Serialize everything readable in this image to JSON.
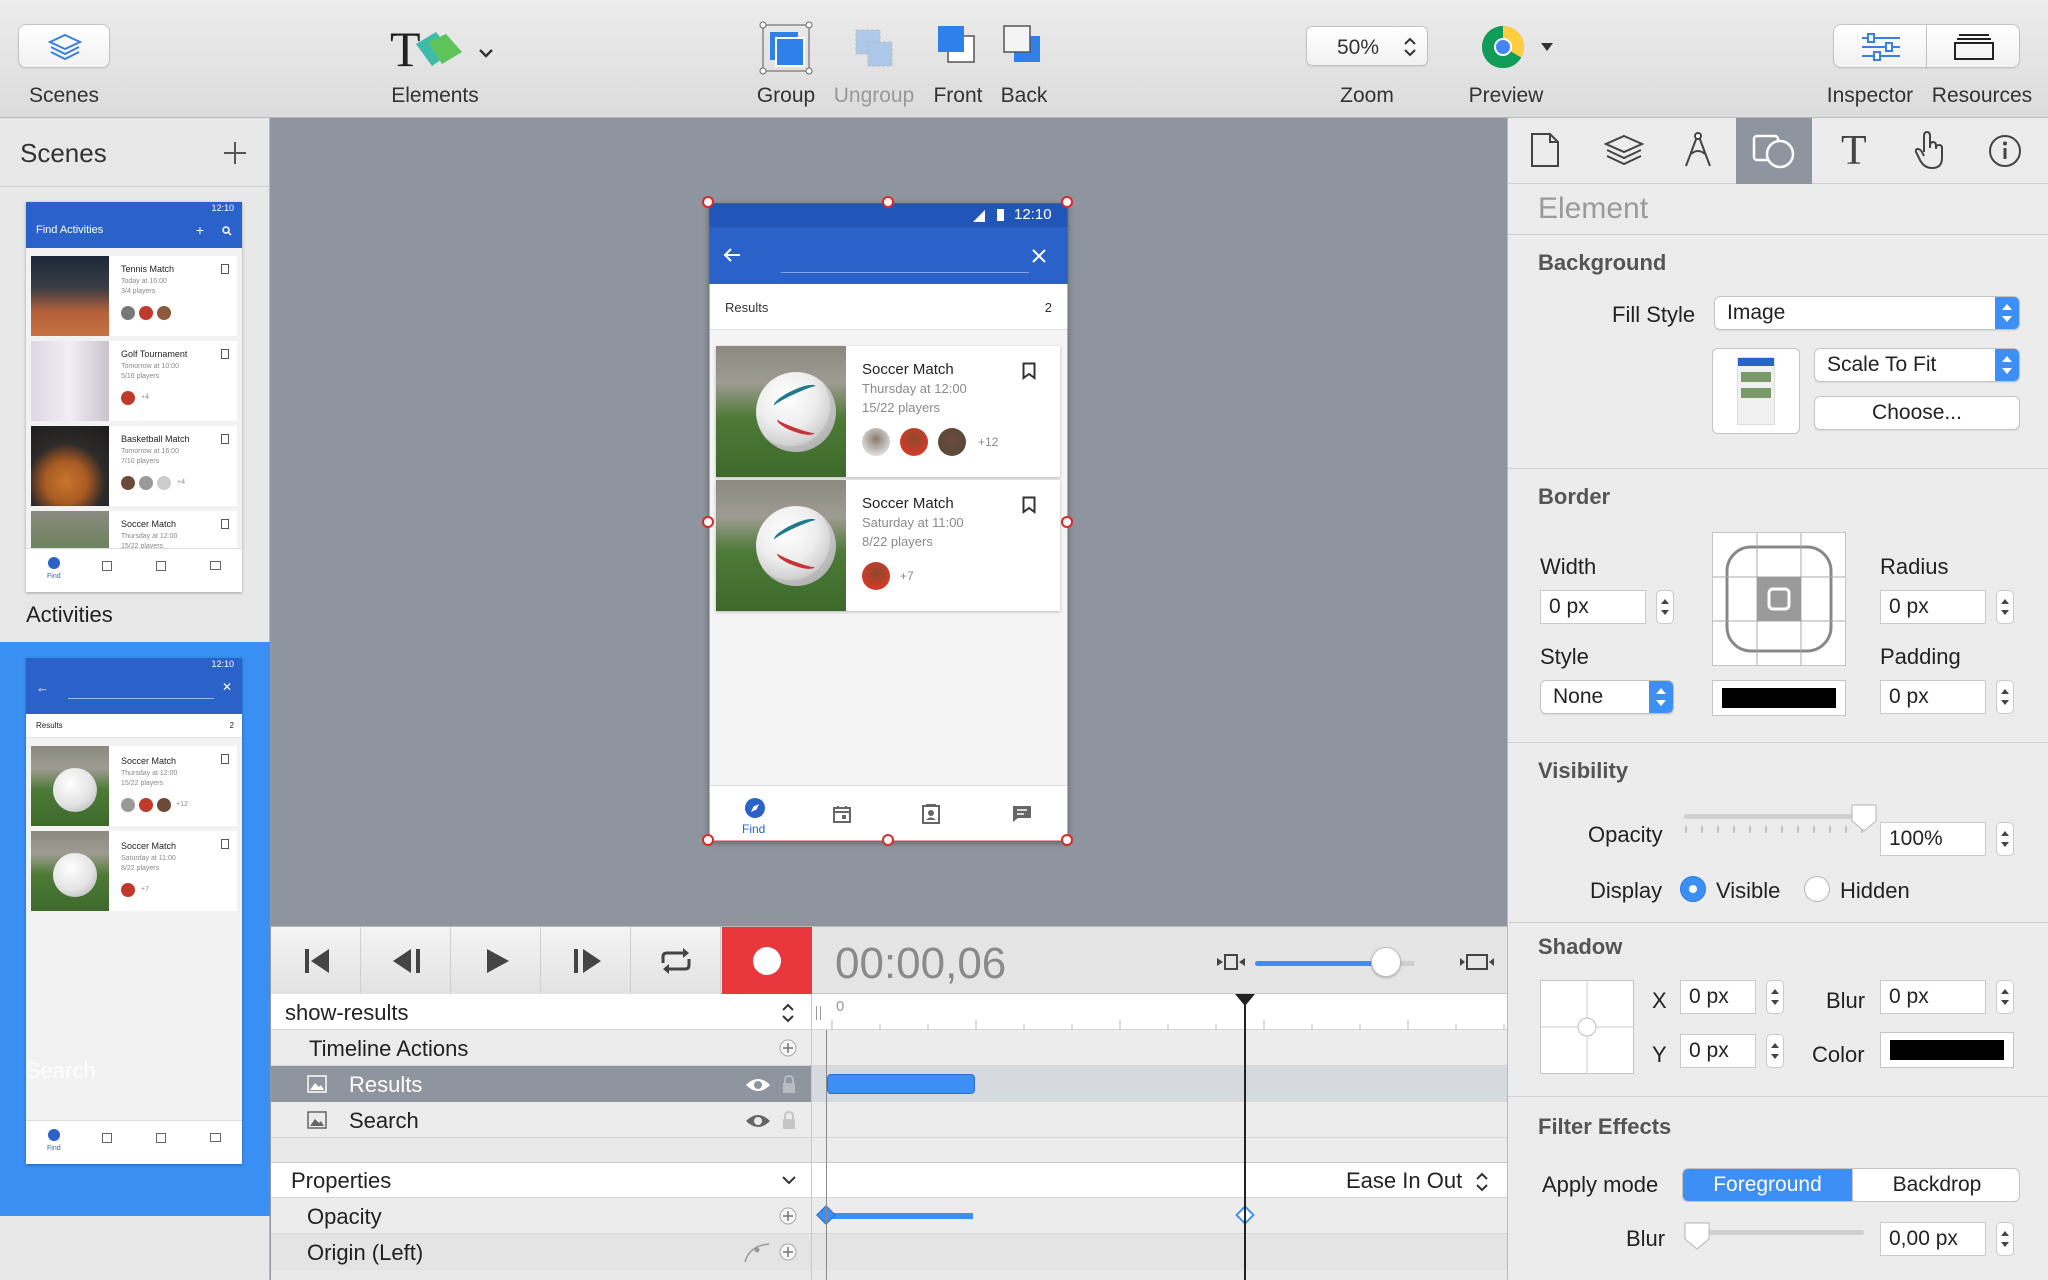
{
  "toolbar": {
    "scenes_label": "Scenes",
    "elements_label": "Elements",
    "group_label": "Group",
    "ungroup_label": "Ungroup",
    "front_label": "Front",
    "back_label": "Back",
    "zoom_value": "50%",
    "zoom_label": "Zoom",
    "preview_label": "Preview",
    "inspector_label": "Inspector",
    "resources_label": "Resources"
  },
  "scenes_panel": {
    "title": "Scenes",
    "items": [
      {
        "name": "Activities",
        "selected": false,
        "bar_title": "Find Activities",
        "time": "12:10",
        "rows": [
          {
            "title": "Tennis Match",
            "line1": "Today at 16:00",
            "line2": "3/4 players"
          },
          {
            "title": "Golf Tournament",
            "line1": "Tomorrow at 10:00",
            "line2": "5/16 players",
            "more": "+4"
          },
          {
            "title": "Basketball Match",
            "line1": "Tomorrow at 16:00",
            "line2": "7/10 players",
            "more": "+4"
          },
          {
            "title": "Soccer Match",
            "line1": "Thursday at 12:00",
            "line2": "15/22 players"
          }
        ],
        "nav_label": "Find"
      },
      {
        "name": "Search",
        "selected": true,
        "time": "12:10",
        "results_label": "Results",
        "results_count": "2",
        "rows": [
          {
            "title": "Soccer Match",
            "line1": "Thursday at 12:00",
            "line2": "15/22 players",
            "more": "+12"
          },
          {
            "title": "Soccer Match",
            "line1": "Saturday at 11:00",
            "line2": "8/22 players",
            "more": "+7"
          }
        ],
        "nav_label": "Find"
      }
    ]
  },
  "phone": {
    "time": "12:10",
    "results_label": "Results",
    "results_count": "2",
    "cards": [
      {
        "title": "Soccer Match",
        "when": "Thursday at 12:00",
        "players": "15/22 players",
        "more": "+12"
      },
      {
        "title": "Soccer Match",
        "when": "Saturday at 11:00",
        "players": "8/22 players",
        "more": "+7"
      }
    ],
    "nav_find": "Find"
  },
  "timeline": {
    "timecode": "00:00,06",
    "animation_name": "show-results",
    "timeline_actions": "Timeline Actions",
    "layers": [
      "Results",
      "Search"
    ],
    "properties_label": "Properties",
    "easing": "Ease In Out",
    "props": [
      "Opacity",
      "Origin (Left)"
    ],
    "ruler_zero": "0",
    "zoom_level": 0.82
  },
  "inspector": {
    "section_title": "Element",
    "background": {
      "title": "Background",
      "fill_style_label": "Fill Style",
      "fill_style_value": "Image",
      "scale_value": "Scale To Fit",
      "choose_label": "Choose..."
    },
    "border": {
      "title": "Border",
      "width_label": "Width",
      "width_value": "0 px",
      "style_label": "Style",
      "style_value": "None",
      "radius_label": "Radius",
      "radius_value": "0 px",
      "padding_label": "Padding",
      "padding_value": "0 px",
      "color": "#000000"
    },
    "visibility": {
      "title": "Visibility",
      "opacity_label": "Opacity",
      "opacity_value": "100%",
      "opacity_level": 1.0,
      "display_label": "Display",
      "visible_label": "Visible",
      "hidden_label": "Hidden",
      "selected": "Visible"
    },
    "shadow": {
      "title": "Shadow",
      "x_label": "X",
      "x_value": "0 px",
      "y_label": "Y",
      "y_value": "0 px",
      "blur_label": "Blur",
      "blur_value": "0 px",
      "color_label": "Color",
      "color": "#000000"
    },
    "filter": {
      "title": "Filter Effects",
      "apply_mode_label": "Apply mode",
      "foreground_label": "Foreground",
      "backdrop_label": "Backdrop",
      "selected_mode": "Foreground",
      "blur_label": "Blur",
      "blur_value": "0,00 px",
      "blur_level": 0.0
    }
  },
  "colors": {
    "accent": "#3d8ff6",
    "selection": "#3a8ff2",
    "material_blue": "#2b62c9",
    "record_red": "#e8373d"
  }
}
